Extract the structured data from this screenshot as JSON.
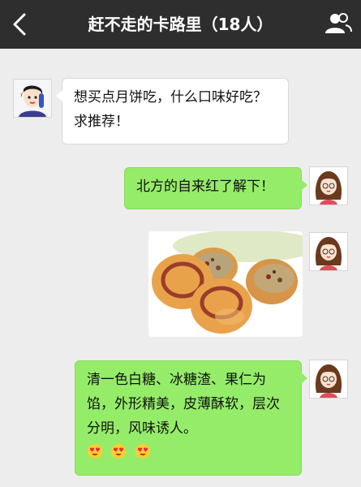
{
  "header": {
    "back_icon": "chevron-left-icon",
    "title": "赶不走的卡路里（18人）",
    "group_icon": "group-members-icon"
  },
  "messages": [
    {
      "sender": "other",
      "avatar": "cartoon-man-avatar",
      "type": "text",
      "text": "想买点月饼吃，什么口味好吃？求推荐！"
    },
    {
      "sender": "self",
      "avatar": "cartoon-girl-avatar",
      "type": "text",
      "text": "北方的自来红了解下！"
    },
    {
      "sender": "self",
      "avatar": "cartoon-girl-avatar",
      "type": "image",
      "image": "mooncake-photo"
    },
    {
      "sender": "self",
      "avatar": "cartoon-girl-avatar",
      "type": "text",
      "text": "清一色白糖、冰糖渣、果仁为馅，外形精美，皮薄酥软，层次分明，风味诱人。",
      "emojis": [
        "heart-eyes-emoji",
        "heart-eyes-emoji",
        "heart-eyes-emoji"
      ]
    }
  ],
  "colors": {
    "topbar": "#2e2e2e",
    "background": "#ededed",
    "self_bubble": "#95ec69",
    "other_bubble": "#ffffff"
  }
}
